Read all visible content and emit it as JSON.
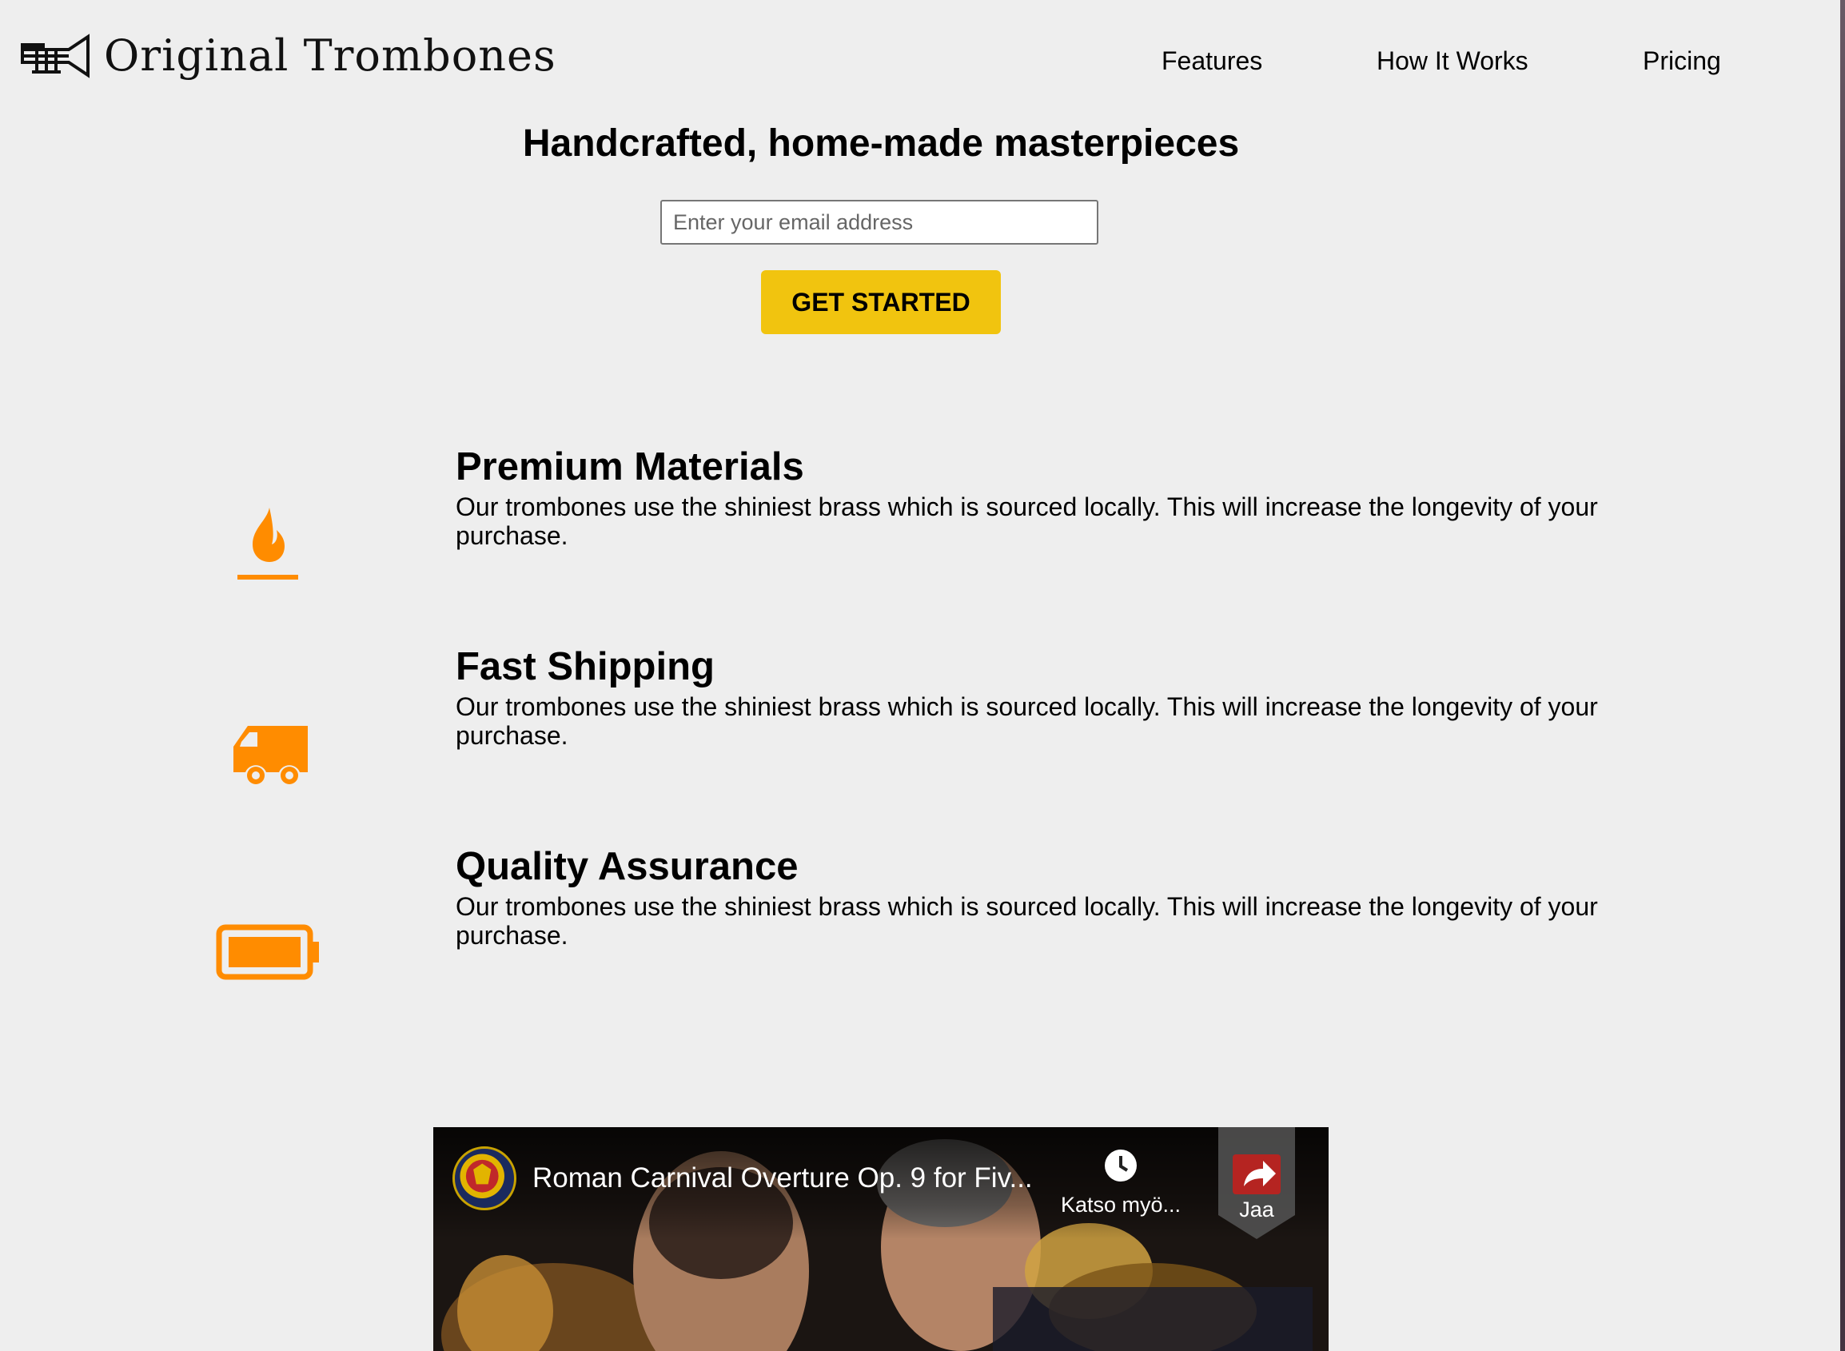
{
  "header": {
    "brand": "Original Trombones",
    "nav": {
      "features": "Features",
      "how_it_works": "How It Works",
      "pricing": "Pricing"
    }
  },
  "hero": {
    "title": "Handcrafted, home-made masterpieces",
    "email_placeholder": "Enter your email address",
    "cta_label": "GET STARTED"
  },
  "features": [
    {
      "icon": "fire-icon",
      "title": "Premium Materials",
      "description": "Our trombones use the shiniest brass which is sourced locally. This will increase the longevity of your purchase."
    },
    {
      "icon": "truck-icon",
      "title": "Fast Shipping",
      "description": "Our trombones use the shiniest brass which is sourced locally. This will increase the longevity of your purchase."
    },
    {
      "icon": "battery-icon",
      "title": "Quality Assurance",
      "description": "Our trombones use the shiniest brass which is sourced locally. This will increase the longevity of your purchase."
    }
  ],
  "video": {
    "title": "Roman Carnival Overture Op. 9 for Fiv...",
    "watch_later_label": "Katso myö...",
    "share_label": "Jaa"
  },
  "colors": {
    "accent": "#f1c40f",
    "icon": "#ff8c00",
    "background": "#eeeeee"
  }
}
